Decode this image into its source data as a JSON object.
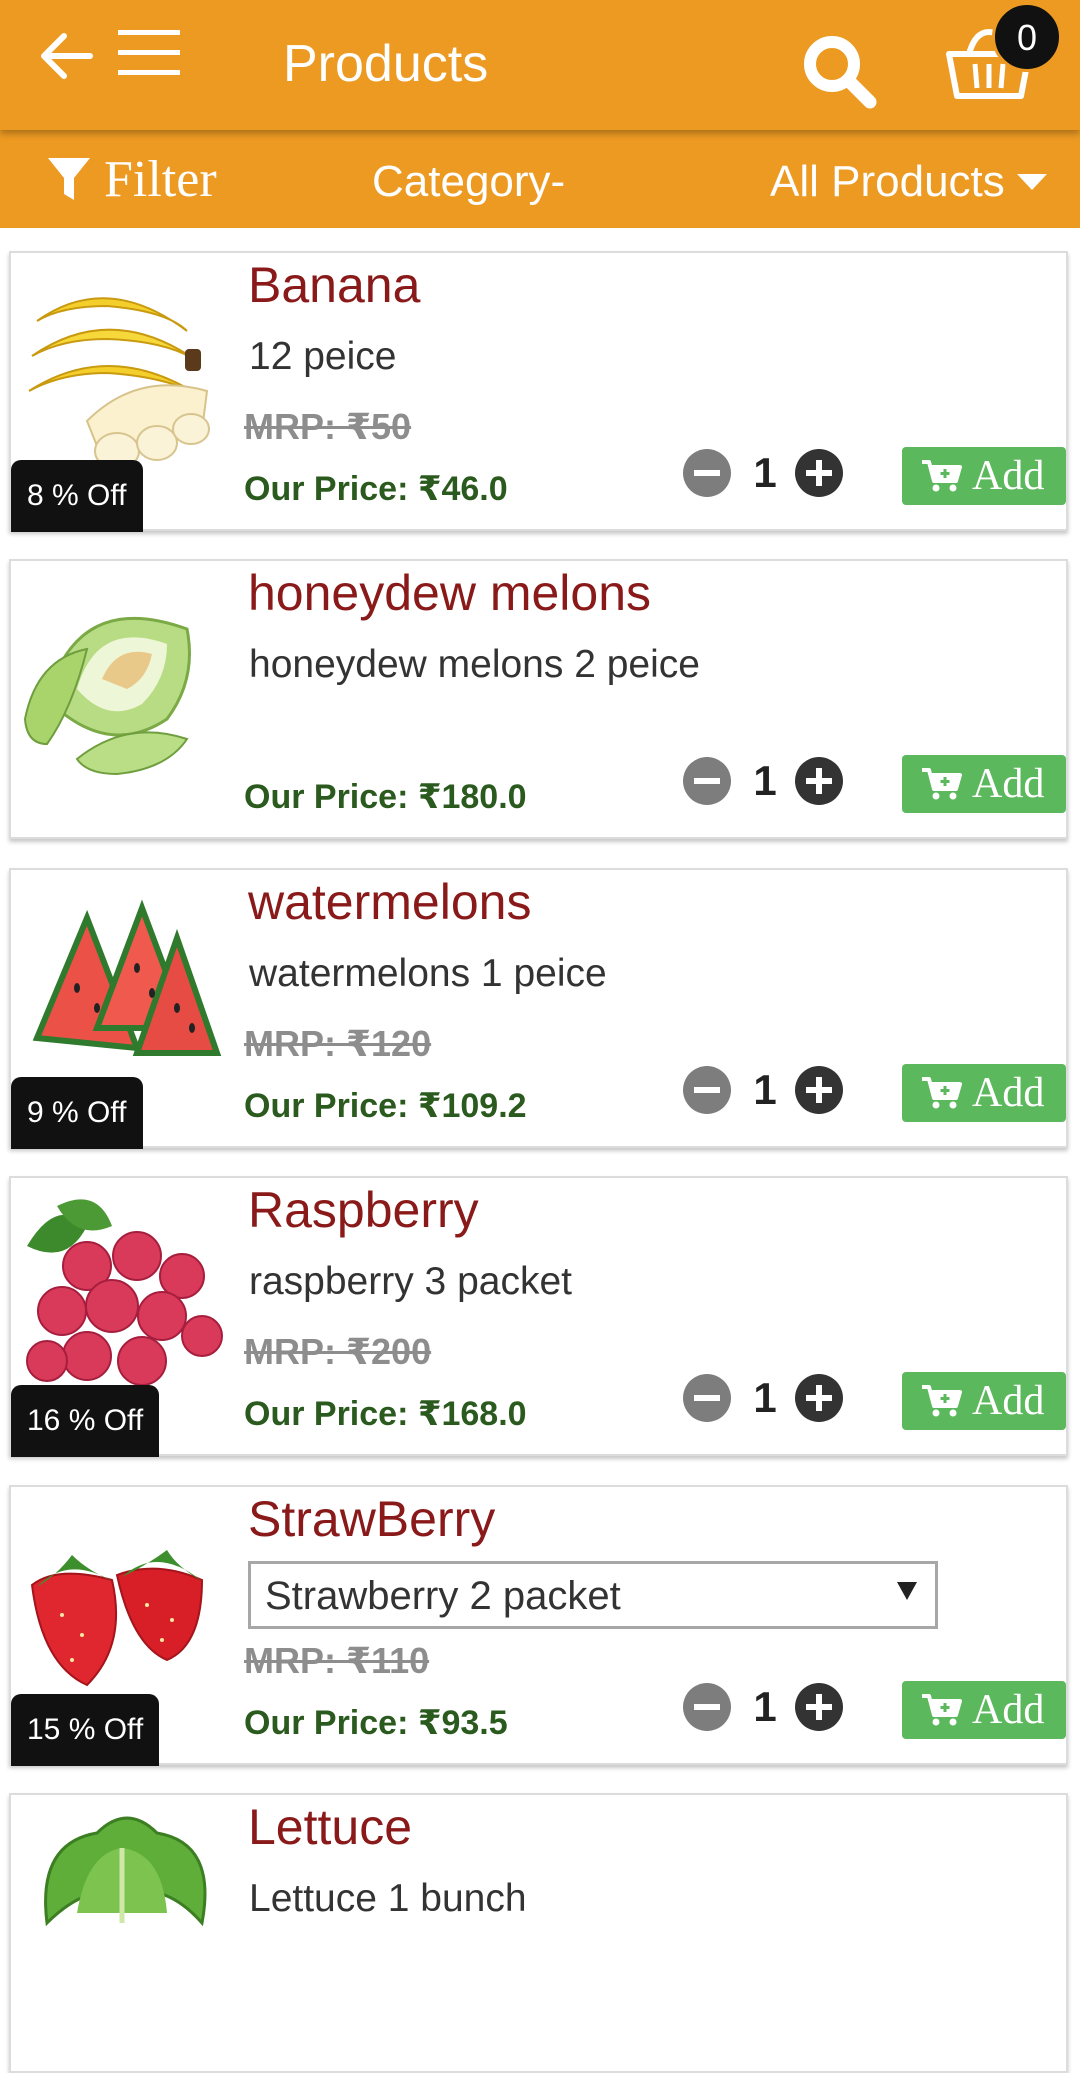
{
  "header": {
    "title": "Products",
    "cart_count": "0"
  },
  "filterbar": {
    "filter_label": "Filter",
    "category_label": "Category-",
    "category_value": "All Products"
  },
  "common": {
    "add_label": "Add"
  },
  "products": [
    {
      "name": "Banana",
      "description": "12 peice",
      "mrp": "MRP: ₹50",
      "our_price": "Our Price: ₹46.0",
      "discount": "8 % Off",
      "quantity": "1"
    },
    {
      "name": "honeydew melons",
      "description": "honeydew melons 2 peice",
      "our_price": "Our Price: ₹180.0",
      "quantity": "1"
    },
    {
      "name": "watermelons",
      "description": "watermelons 1 peice",
      "mrp": "MRP: ₹120",
      "our_price": "Our Price: ₹109.2",
      "discount": "9 % Off",
      "quantity": "1"
    },
    {
      "name": "Raspberry",
      "description": "raspberry 3 packet",
      "mrp": "MRP: ₹200",
      "our_price": "Our Price: ₹168.0",
      "discount": "16 % Off",
      "quantity": "1"
    },
    {
      "name": "StrawBerry",
      "variant_selected": "Strawberry 2 packet",
      "mrp": "MRP: ₹110",
      "our_price": "Our Price: ₹93.5",
      "discount": "15 % Off",
      "quantity": "1"
    },
    {
      "name": "Lettuce",
      "description": "Lettuce 1 bunch"
    }
  ],
  "colors": {
    "accent": "#ec9a22",
    "product_name": "#8a1a1a",
    "price_green": "#2b5a1e",
    "add_button": "#5cb85c",
    "badge": "#111111"
  }
}
